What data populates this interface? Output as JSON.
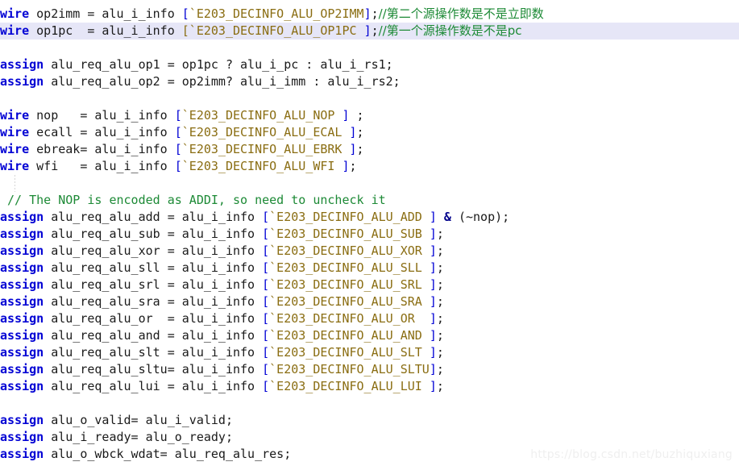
{
  "editor": {
    "background": "#ffffff",
    "highlight_background": "#e6e6f7",
    "colors": {
      "keyword": "#0000d4",
      "macro": "#8a6d12",
      "comment": "#1d8a36",
      "punctuation": "#0000d4",
      "operator": "#00008b",
      "text": "#1a1a1a",
      "watermark": "#efefef"
    },
    "watermark": "https://blog.csdn.net/buzhiquxiang",
    "language": "verilog",
    "lines": [
      {
        "id": 1,
        "highlighted": false,
        "tokens": [
          {
            "t": "wire",
            "c": "kw"
          },
          {
            "t": " op2imm = alu_i_info ",
            "c": "plain"
          },
          {
            "t": "[",
            "c": "punct"
          },
          {
            "t": "`E203_DECINFO_ALU_OP2IMM",
            "c": "macro"
          },
          {
            "t": "]",
            "c": "punct"
          },
          {
            "t": ";",
            "c": "plain"
          },
          {
            "t": "//第二个源操作数是不是立即数",
            "c": "comment"
          }
        ]
      },
      {
        "id": 2,
        "highlighted": true,
        "tokens": [
          {
            "t": "wire",
            "c": "kw"
          },
          {
            "t": " op1pc  = alu_i_info ",
            "c": "plain"
          },
          {
            "t": "[`E203_DECINFO_ALU_OP1PC ",
            "c": "macro",
            "brackets": true
          },
          {
            "t": "]",
            "c": "punct"
          },
          {
            "t": ";",
            "c": "plain"
          },
          {
            "t": "//第一个源操作数是不是pc",
            "c": "comment"
          }
        ]
      },
      {
        "id": 3,
        "highlighted": false,
        "tokens": []
      },
      {
        "id": 4,
        "highlighted": false,
        "tokens": [
          {
            "t": "assign",
            "c": "kw"
          },
          {
            "t": " alu_req_alu_op1 = op1pc ? alu_i_pc : alu_i_rs1;",
            "c": "plain"
          }
        ]
      },
      {
        "id": 5,
        "highlighted": false,
        "tokens": [
          {
            "t": "assign",
            "c": "kw"
          },
          {
            "t": " alu_req_alu_op2 = op2imm? alu_i_imm : alu_i_rs2;",
            "c": "plain"
          }
        ]
      },
      {
        "id": 6,
        "highlighted": false,
        "tokens": []
      },
      {
        "id": 7,
        "highlighted": false,
        "tokens": [
          {
            "t": "wire",
            "c": "kw"
          },
          {
            "t": " nop   = alu_i_info ",
            "c": "plain"
          },
          {
            "t": "[",
            "c": "punct"
          },
          {
            "t": "`E203_DECINFO_ALU_NOP ",
            "c": "macro"
          },
          {
            "t": "]",
            "c": "punct"
          },
          {
            "t": " ;",
            "c": "plain"
          }
        ]
      },
      {
        "id": 8,
        "highlighted": false,
        "tokens": [
          {
            "t": "wire",
            "c": "kw"
          },
          {
            "t": " ecall = alu_i_info ",
            "c": "plain"
          },
          {
            "t": "[",
            "c": "punct"
          },
          {
            "t": "`E203_DECINFO_ALU_ECAL ",
            "c": "macro"
          },
          {
            "t": "]",
            "c": "punct"
          },
          {
            "t": ";",
            "c": "plain"
          }
        ]
      },
      {
        "id": 9,
        "highlighted": false,
        "tokens": [
          {
            "t": "wire",
            "c": "kw"
          },
          {
            "t": " ebreak= alu_i_info ",
            "c": "plain"
          },
          {
            "t": "[",
            "c": "punct"
          },
          {
            "t": "`E203_DECINFO_ALU_EBRK ",
            "c": "macro"
          },
          {
            "t": "]",
            "c": "punct"
          },
          {
            "t": ";",
            "c": "plain"
          }
        ]
      },
      {
        "id": 10,
        "highlighted": false,
        "tokens": [
          {
            "t": "wire",
            "c": "kw"
          },
          {
            "t": " wfi   = alu_i_info ",
            "c": "plain"
          },
          {
            "t": "[",
            "c": "punct"
          },
          {
            "t": "`E203_DECINFO_ALU_WFI ",
            "c": "macro"
          },
          {
            "t": "]",
            "c": "punct"
          },
          {
            "t": ";",
            "c": "plain"
          }
        ]
      },
      {
        "id": 11,
        "highlighted": false,
        "guide": true,
        "tokens": []
      },
      {
        "id": 12,
        "highlighted": false,
        "tokens": [
          {
            "t": " // The NOP is encoded as ADDI, so need to uncheck it",
            "c": "comment"
          }
        ]
      },
      {
        "id": 13,
        "highlighted": false,
        "tokens": [
          {
            "t": "assign",
            "c": "kw"
          },
          {
            "t": " alu_req_alu_add = alu_i_info ",
            "c": "plain"
          },
          {
            "t": "[",
            "c": "punct"
          },
          {
            "t": "`E203_DECINFO_ALU_ADD ",
            "c": "macro"
          },
          {
            "t": "]",
            "c": "punct"
          },
          {
            "t": " ",
            "c": "plain"
          },
          {
            "t": "&",
            "c": "op"
          },
          {
            "t": " (~nop);",
            "c": "plain"
          }
        ]
      },
      {
        "id": 14,
        "highlighted": false,
        "tokens": [
          {
            "t": "assign",
            "c": "kw"
          },
          {
            "t": " alu_req_alu_sub = alu_i_info ",
            "c": "plain"
          },
          {
            "t": "[",
            "c": "punct"
          },
          {
            "t": "`E203_DECINFO_ALU_SUB ",
            "c": "macro"
          },
          {
            "t": "]",
            "c": "punct"
          },
          {
            "t": ";",
            "c": "plain"
          }
        ]
      },
      {
        "id": 15,
        "highlighted": false,
        "tokens": [
          {
            "t": "assign",
            "c": "kw"
          },
          {
            "t": " alu_req_alu_xor = alu_i_info ",
            "c": "plain"
          },
          {
            "t": "[",
            "c": "punct"
          },
          {
            "t": "`E203_DECINFO_ALU_XOR ",
            "c": "macro"
          },
          {
            "t": "]",
            "c": "punct"
          },
          {
            "t": ";",
            "c": "plain"
          }
        ]
      },
      {
        "id": 16,
        "highlighted": false,
        "tokens": [
          {
            "t": "assign",
            "c": "kw"
          },
          {
            "t": " alu_req_alu_sll = alu_i_info ",
            "c": "plain"
          },
          {
            "t": "[",
            "c": "punct"
          },
          {
            "t": "`E203_DECINFO_ALU_SLL ",
            "c": "macro"
          },
          {
            "t": "]",
            "c": "punct"
          },
          {
            "t": ";",
            "c": "plain"
          }
        ]
      },
      {
        "id": 17,
        "highlighted": false,
        "tokens": [
          {
            "t": "assign",
            "c": "kw"
          },
          {
            "t": " alu_req_alu_srl = alu_i_info ",
            "c": "plain"
          },
          {
            "t": "[",
            "c": "punct"
          },
          {
            "t": "`E203_DECINFO_ALU_SRL ",
            "c": "macro"
          },
          {
            "t": "]",
            "c": "punct"
          },
          {
            "t": ";",
            "c": "plain"
          }
        ]
      },
      {
        "id": 18,
        "highlighted": false,
        "tokens": [
          {
            "t": "assign",
            "c": "kw"
          },
          {
            "t": " alu_req_alu_sra = alu_i_info ",
            "c": "plain"
          },
          {
            "t": "[",
            "c": "punct"
          },
          {
            "t": "`E203_DECINFO_ALU_SRA ",
            "c": "macro"
          },
          {
            "t": "]",
            "c": "punct"
          },
          {
            "t": ";",
            "c": "plain"
          }
        ]
      },
      {
        "id": 19,
        "highlighted": false,
        "tokens": [
          {
            "t": "assign",
            "c": "kw"
          },
          {
            "t": " alu_req_alu_or  = alu_i_info ",
            "c": "plain"
          },
          {
            "t": "[",
            "c": "punct"
          },
          {
            "t": "`E203_DECINFO_ALU_OR  ",
            "c": "macro"
          },
          {
            "t": "]",
            "c": "punct"
          },
          {
            "t": ";",
            "c": "plain"
          }
        ]
      },
      {
        "id": 20,
        "highlighted": false,
        "tokens": [
          {
            "t": "assign",
            "c": "kw"
          },
          {
            "t": " alu_req_alu_and = alu_i_info ",
            "c": "plain"
          },
          {
            "t": "[",
            "c": "punct"
          },
          {
            "t": "`E203_DECINFO_ALU_AND ",
            "c": "macro"
          },
          {
            "t": "]",
            "c": "punct"
          },
          {
            "t": ";",
            "c": "plain"
          }
        ]
      },
      {
        "id": 21,
        "highlighted": false,
        "tokens": [
          {
            "t": "assign",
            "c": "kw"
          },
          {
            "t": " alu_req_alu_slt = alu_i_info ",
            "c": "plain"
          },
          {
            "t": "[",
            "c": "punct"
          },
          {
            "t": "`E203_DECINFO_ALU_SLT ",
            "c": "macro"
          },
          {
            "t": "]",
            "c": "punct"
          },
          {
            "t": ";",
            "c": "plain"
          }
        ]
      },
      {
        "id": 22,
        "highlighted": false,
        "tokens": [
          {
            "t": "assign",
            "c": "kw"
          },
          {
            "t": " alu_req_alu_sltu= alu_i_info ",
            "c": "plain"
          },
          {
            "t": "[",
            "c": "punct"
          },
          {
            "t": "`E203_DECINFO_ALU_SLTU",
            "c": "macro"
          },
          {
            "t": "]",
            "c": "punct"
          },
          {
            "t": ";",
            "c": "plain"
          }
        ]
      },
      {
        "id": 23,
        "highlighted": false,
        "tokens": [
          {
            "t": "assign",
            "c": "kw"
          },
          {
            "t": " alu_req_alu_lui = alu_i_info ",
            "c": "plain"
          },
          {
            "t": "[",
            "c": "punct"
          },
          {
            "t": "`E203_DECINFO_ALU_LUI ",
            "c": "macro"
          },
          {
            "t": "]",
            "c": "punct"
          },
          {
            "t": ";",
            "c": "plain"
          }
        ]
      },
      {
        "id": 24,
        "highlighted": false,
        "tokens": []
      },
      {
        "id": 25,
        "highlighted": false,
        "tokens": [
          {
            "t": "assign",
            "c": "kw"
          },
          {
            "t": " alu_o_valid= alu_i_valid;",
            "c": "plain"
          }
        ]
      },
      {
        "id": 26,
        "highlighted": false,
        "tokens": [
          {
            "t": "assign",
            "c": "kw"
          },
          {
            "t": " alu_i_ready= alu_o_ready;",
            "c": "plain"
          }
        ]
      },
      {
        "id": 27,
        "highlighted": false,
        "tokens": [
          {
            "t": "assign",
            "c": "kw"
          },
          {
            "t": " alu_o_wbck_wdat= alu_req_alu_res;",
            "c": "plain"
          }
        ]
      }
    ]
  }
}
